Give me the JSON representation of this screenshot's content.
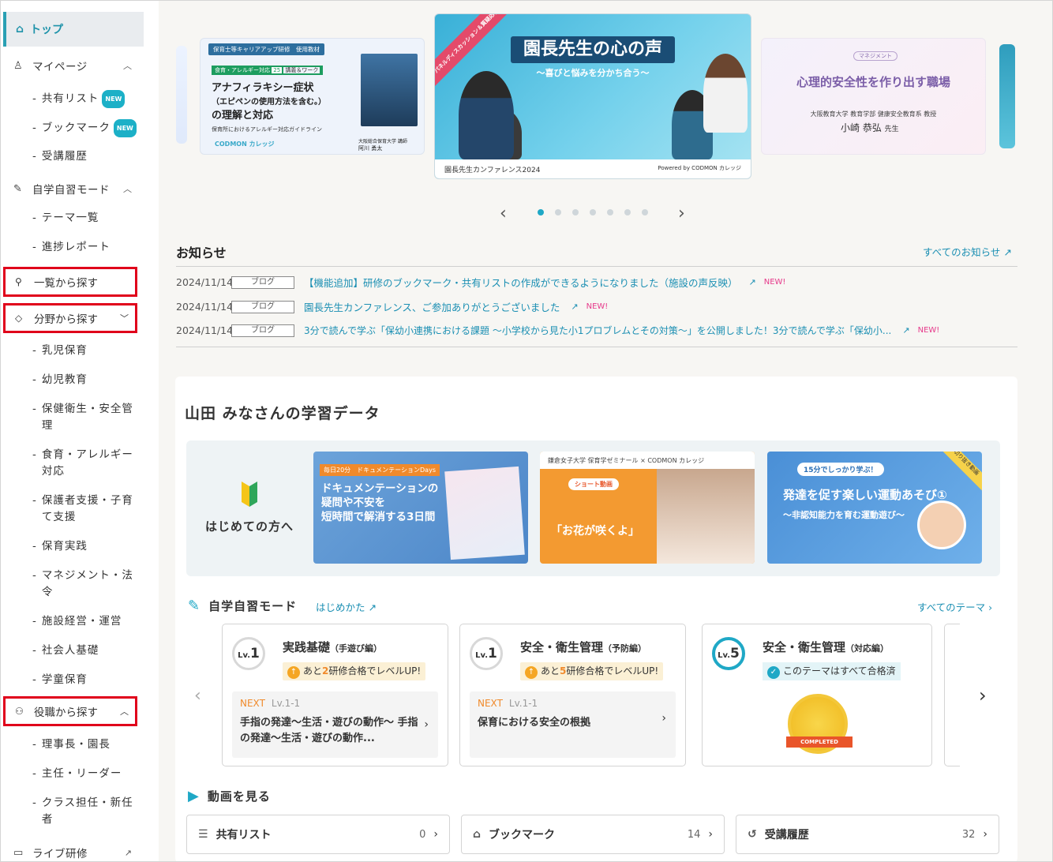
{
  "sidebar": {
    "top": "トップ",
    "mypage": "マイページ",
    "mypage_items": [
      {
        "label": "共有リスト",
        "badge": "NEW"
      },
      {
        "label": "ブックマーク",
        "badge": "NEW"
      },
      {
        "label": "受講履歴",
        "badge": ""
      }
    ],
    "selfstudy": "自学自習モード",
    "selfstudy_items": [
      "テーマ一覧",
      "進捗レポート"
    ],
    "list_search": "一覧から探す",
    "field_search": "分野から探す",
    "field_items": [
      "乳児保育",
      "幼児教育",
      "保健衛生・安全管理",
      "食育・アレルギー対応",
      "保護者支援・子育て支援",
      "保育実践",
      "マネジメント・法令",
      "施設経営・運営",
      "社会人基礎",
      "学童保育"
    ],
    "role_search": "役職から探す",
    "role_items": [
      "理事長・園長",
      "主任・リーダー",
      "クラス担任・新任者"
    ],
    "live": "ライブ研修"
  },
  "carousel": {
    "slide1": {
      "header": "保育士等キャリアアップ研修　使用教材",
      "tag": "食育・アレルギー対応",
      "tag_num": "25",
      "tag_suffix": "講義＆ワーク",
      "title": "アナフィラキシー症状",
      "subtitle": "（エピペンの使用方法を含む。）",
      "title2": "の理解と対応",
      "caption": "保育所におけるアレルギー対応ガイドライン",
      "org": "大阪総合保育大学 講師",
      "name": "阿川 勇太",
      "logo": "CODMON カレッジ"
    },
    "slide2": {
      "band": "パネルディスカッション＆質疑応答",
      "title": "園長先生の心の声",
      "subtitle": "〜喜びと悩みを分かち合う〜",
      "footer": "園長先生カンファレンス2024",
      "powered": "Powered by CODMON カレッジ"
    },
    "slide3": {
      "pill": "マネジメント",
      "title": "心理的安全性を作り出す職場",
      "org": "大阪教育大学 教育学部 健康安全教育系 教授",
      "name": "小崎 恭弘",
      "suffix": "先生"
    },
    "active_dot": 0,
    "dot_count": 7
  },
  "news": {
    "title": "お知らせ",
    "all_link": "すべてのお知らせ",
    "items": [
      {
        "date": "2024/11/14",
        "badge": "ブログ",
        "text": "【機能追加】研修のブックマーク・共有リストの作成ができるようになりました（施設の声反映）",
        "new": "NEW!"
      },
      {
        "date": "2024/11/14",
        "badge": "ブログ",
        "text": "園長先生カンファレンス、ご参加ありがとうございました",
        "new": "NEW!"
      },
      {
        "date": "2024/11/14",
        "badge": "ブログ",
        "text": "3分で読んで学ぶ「保幼小連携における課題 〜小学校から見た小1プロブレムとその対策〜」を公開しました！3分で読んで学ぶ「保幼小...",
        "new": "NEW!"
      }
    ]
  },
  "learning": {
    "title": "山田 みなさんの学習データ",
    "intro_label": "はじめての方へ",
    "banners": [
      {
        "head": "毎日20分　ドキュメンテーションDays",
        "title": "ドキュメンテーションの\n疑問や不安を\n短時間で解消する3日間"
      },
      {
        "head": "鎌倉女子大学 保育学ゼミナール × CODMON カレッジ",
        "tag": "ショート動画",
        "quote": "「お花が咲くよ」"
      },
      {
        "head": "15分でしっかり学ぶ！",
        "title": "発達を促す楽しい運動あそび①",
        "sub": "〜非認知能力を育む運動遊び〜",
        "corner": "切り抜き動画"
      }
    ],
    "selfstudy_title": "自学自習モード",
    "howto": "はじめかた",
    "all_themes": "すべてのテーマ",
    "themes": [
      {
        "lv": "1",
        "name": "実践基礎",
        "sub": "（手遊び編）",
        "remain_pre": "あと",
        "remain_num": "2",
        "remain_post": "研修合格でレベルUP!",
        "next": "NEXT",
        "next_lv": "Lv.1-1",
        "next_title": "手指の発達〜生活・遊びの動作〜 手指の発達〜生活・遊びの動作..."
      },
      {
        "lv": "1",
        "name": "安全・衛生管理",
        "sub": "（予防編）",
        "remain_pre": "あと",
        "remain_num": "5",
        "remain_post": "研修合格でレベルUP!",
        "next": "NEXT",
        "next_lv": "Lv.1-1",
        "next_title": "保育における安全の根拠"
      },
      {
        "lv": "5",
        "name": "安全・衛生管理",
        "sub": "（対応編）",
        "passed": "このテーマはすべて合格済",
        "medal": "COMPLETED"
      }
    ],
    "video_title": "動画を見る",
    "video_links": [
      {
        "label": "共有リスト",
        "count": "0"
      },
      {
        "label": "ブックマーク",
        "count": "14"
      },
      {
        "label": "受講履歴",
        "count": "32"
      }
    ]
  },
  "colors": {
    "accent": "#1fa8c6",
    "highlight_box": "#e0001b",
    "new_badge": "#e6398a"
  }
}
